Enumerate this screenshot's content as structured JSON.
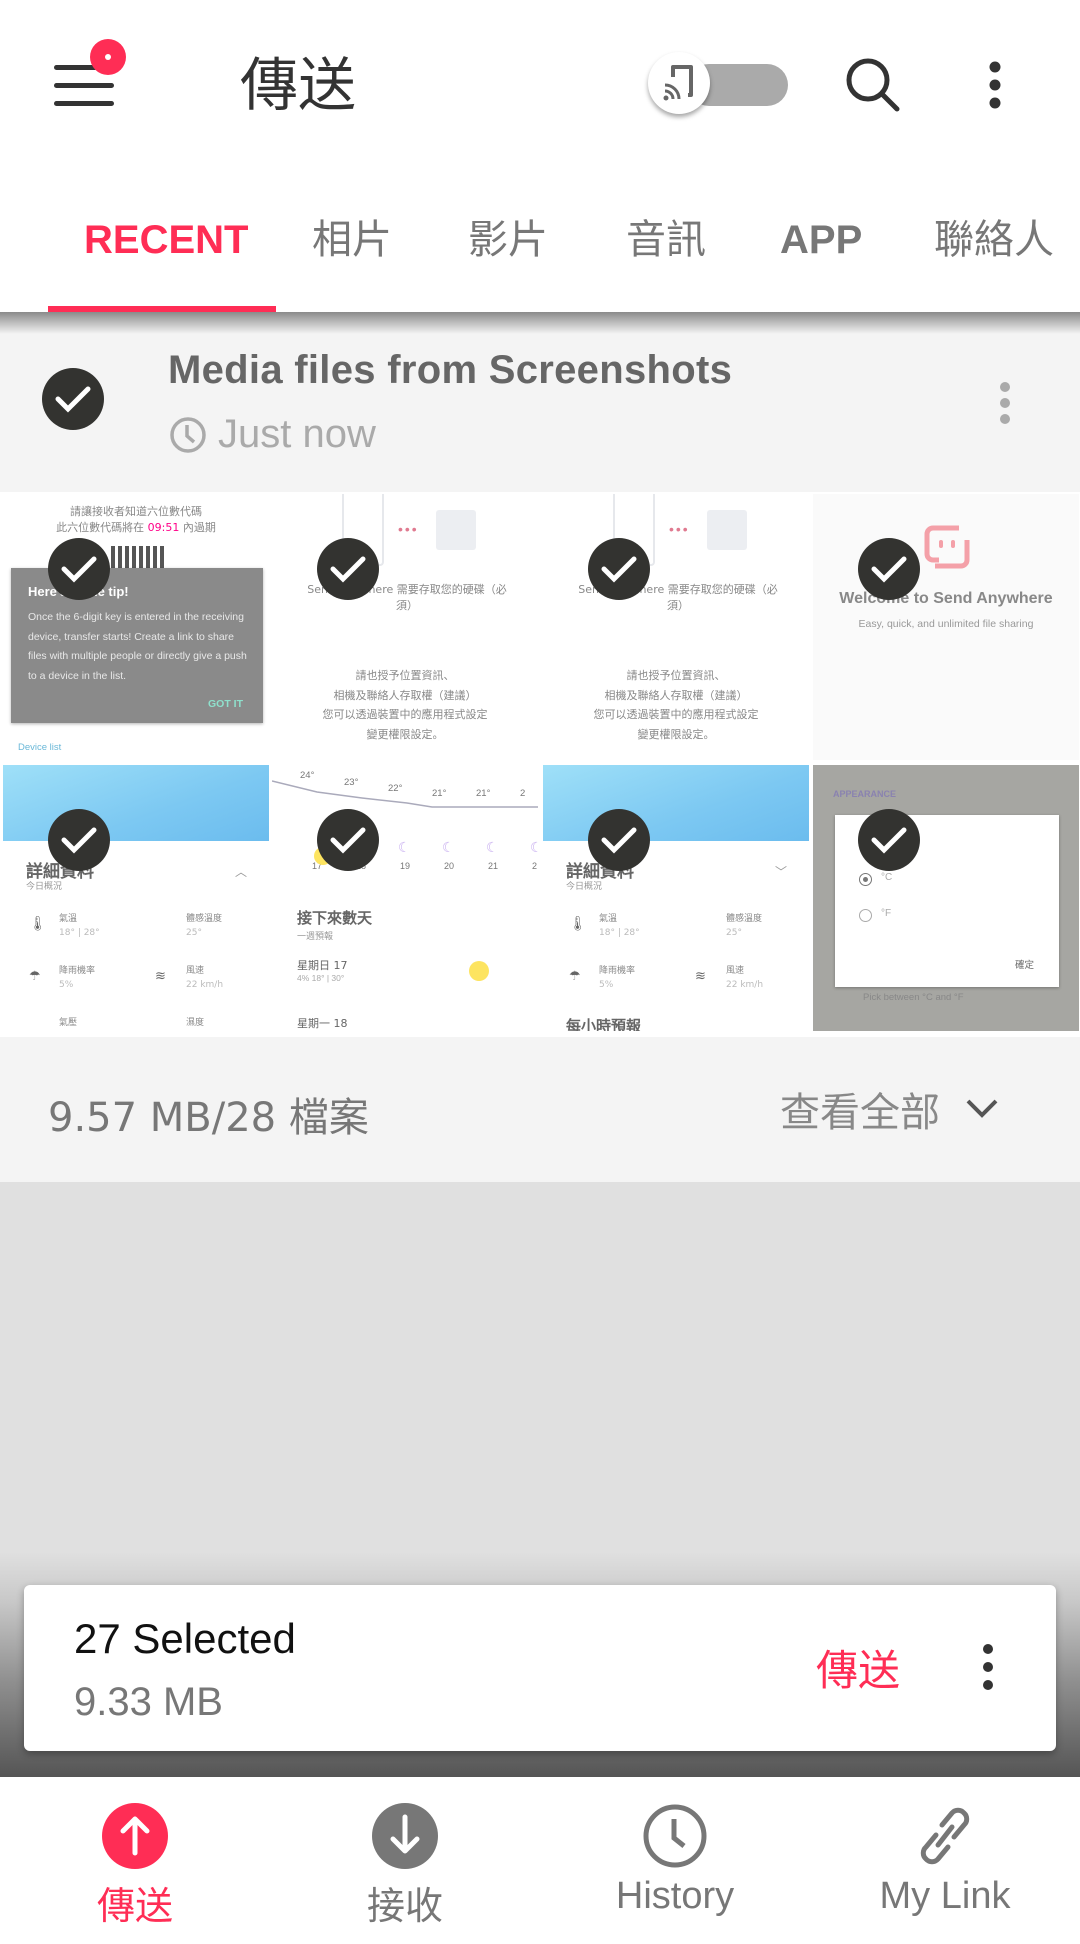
{
  "app": {
    "title": "傳送",
    "accent_color": "#ff2d55",
    "menu_has_badge": true,
    "toggle": {
      "icon": "cast-phone-icon",
      "state": "off"
    },
    "actions": [
      "search-icon",
      "more-vert-icon"
    ]
  },
  "tabs": [
    {
      "label": "RECENT",
      "active": true
    },
    {
      "label": "相片",
      "active": false
    },
    {
      "label": "影片",
      "active": false
    },
    {
      "label": "音訊",
      "active": false
    },
    {
      "label": "APP",
      "active": false
    },
    {
      "label": "聯絡人",
      "active": false
    }
  ],
  "group": {
    "title": "Media files from Screenshots",
    "time": "Just now",
    "checked": true,
    "footer_size": "9.57 MB/28 檔案",
    "view_all": "查看全部"
  },
  "thumbnails": [
    {
      "checked": true,
      "line1": "請讓接收者知道六位數代碼",
      "line2_pre": "此六位數代碼將在 ",
      "line2_time": "09:51",
      "line2_post": " 內過期",
      "tip_title": "Here's some tip!",
      "tip_body": "Once the 6-digit key is entered in the receiving device, transfer starts! Create a link to share files with multiple people or directly give a push to a device in the list.",
      "tip_button": "GOT IT",
      "device_list": "Device list"
    },
    {
      "checked": true,
      "perm_title": "Send Anywhere 需要存取您的硬碟（必須）",
      "perm_lines": [
        "請也授予位置資訊、",
        "相機及聯絡人存取權（建議）",
        "您可以透過裝置中的應用程式設定",
        "變更權限設定。"
      ]
    },
    {
      "checked": true,
      "perm_title": "Send Anywhere 需要存取您的硬碟（必須）",
      "perm_lines": [
        "請也授予位置資訊、",
        "相機及聯絡人存取權（建議）",
        "您可以透過裝置中的應用程式設定",
        "變更權限設定。"
      ]
    },
    {
      "checked": true,
      "welcome_title": "Welcome to Send Anywhere",
      "welcome_sub": "Easy, quick, and unlimited file sharing"
    },
    {
      "checked": true,
      "heading": "詳細資料",
      "subheading": "今日概況",
      "stats": [
        {
          "label": "氣溫",
          "value": "18° | 28°"
        },
        {
          "label": "體感溫度",
          "value": "25°"
        },
        {
          "label": "降雨機率",
          "value": "5%"
        },
        {
          "label": "風速",
          "value": "22 km/h"
        },
        {
          "label": "氣壓",
          "value": ""
        },
        {
          "label": "濕度",
          "value": ""
        }
      ]
    },
    {
      "checked": true,
      "temps": [
        "24°",
        "23°",
        "22°",
        "21°",
        "21°",
        "2"
      ],
      "hours": [
        "17",
        "18",
        "19",
        "20",
        "21",
        "2"
      ],
      "heading": "接下來數天",
      "subheading": "一週預報",
      "day1": "星期日 17",
      "day1_detail": "4%   18° | 30°",
      "day2": "星期一 18"
    },
    {
      "checked": true,
      "heading": "詳細資料",
      "subheading": "今日概況",
      "stats": [
        {
          "label": "氣溫",
          "value": "18° | 28°"
        },
        {
          "label": "體感溫度",
          "value": "25°"
        },
        {
          "label": "降雨機率",
          "value": "5%"
        },
        {
          "label": "風速",
          "value": "22 km/h"
        }
      ],
      "footer": "每小時預報"
    },
    {
      "checked": true,
      "section": "APPEARANCE",
      "options": [
        "°C",
        "°F"
      ],
      "selected": "°C",
      "confirm": "確定",
      "behind_sub": "Pick between °C and °F"
    }
  ],
  "selection": {
    "count_label": "27 Selected",
    "size": "9.33 MB",
    "send_label": "傳送"
  },
  "bottom_nav": [
    {
      "label": "傳送",
      "icon": "upload-circle-icon",
      "active": true
    },
    {
      "label": "接收",
      "icon": "download-circle-icon",
      "active": false
    },
    {
      "label": "History",
      "icon": "clock-icon",
      "active": false
    },
    {
      "label": "My Link",
      "icon": "link-icon",
      "active": false
    }
  ]
}
